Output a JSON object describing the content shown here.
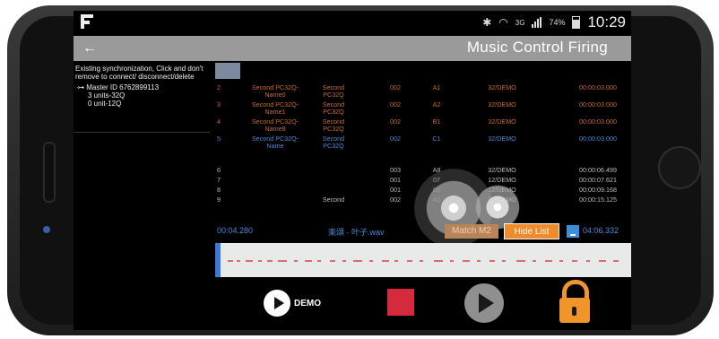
{
  "status": {
    "time": "10:29",
    "network": "3G",
    "battery": "74%",
    "icons": [
      "bluetooth-icon",
      "wifi-icon",
      "signal-icon",
      "battery-icon"
    ]
  },
  "header": {
    "back_icon": "left-arrow-icon",
    "title": "Music Control Firing"
  },
  "left_panel": {
    "hint": "Existing synchronization, Click and don't remove to connect/ disconnect/delete",
    "master": "Master ID 6762899113",
    "units": [
      "3 units-32Q",
      "0 unit-12Q"
    ]
  },
  "table": {
    "rows": [
      {
        "idx": "2",
        "name": "Second PC32Q-Name0",
        "module": "Second PC32Q",
        "num": "002",
        "cue": "A1",
        "desc": "32/DEMO",
        "time": "00:00:03.000",
        "style": "orange"
      },
      {
        "idx": "3",
        "name": "Second PC32Q-Name1",
        "module": "Second PC32Q",
        "num": "002",
        "cue": "A2",
        "desc": "32/DEMO",
        "time": "00:00:03.000",
        "style": "orange"
      },
      {
        "idx": "4",
        "name": "Second PC32Q-Name8",
        "module": "Second PC32Q",
        "num": "002",
        "cue": "B1",
        "desc": "32/DEMO",
        "time": "00:00:03.000",
        "style": "orange"
      },
      {
        "idx": "5",
        "name": "Second PC32Q-Name",
        "module": "Second PC32Q",
        "num": "002",
        "cue": "C1",
        "desc": "32/DEMO",
        "time": "00:00:03.000",
        "style": "blue"
      },
      {
        "idx": "6",
        "name": "",
        "module": "",
        "num": "003",
        "cue": "A8",
        "desc": "32/DEMO",
        "time": "00:00:06.499",
        "style": "white"
      },
      {
        "idx": "7",
        "name": "",
        "module": "",
        "num": "001",
        "cue": "07",
        "desc": "12/DEMO",
        "time": "00:00:07.621",
        "style": "white"
      },
      {
        "idx": "8",
        "name": "",
        "module": "",
        "num": "001",
        "cue": "08",
        "desc": "12/DEMO",
        "time": "00:00:09.168",
        "style": "white"
      },
      {
        "idx": "9",
        "name": "",
        "module": "Second",
        "num": "002",
        "cue": "A3",
        "desc": "32/DEMO",
        "time": "00:00:15.125",
        "style": "white"
      }
    ]
  },
  "playback": {
    "current_time": "00:04.280",
    "song": "楽頌 · 叶子.wav",
    "match_label": "Match M2",
    "hide_list_label": "Hide List",
    "total_time": "04:06.332"
  },
  "controls": {
    "demo_label": "DEMO"
  },
  "colors": {
    "title_bar": "#9a9a9a",
    "accent_blue": "#4a88d8",
    "accent_orange": "#f08a2a",
    "stop_red": "#d42a3c",
    "row_orange": "#c96a2a"
  }
}
